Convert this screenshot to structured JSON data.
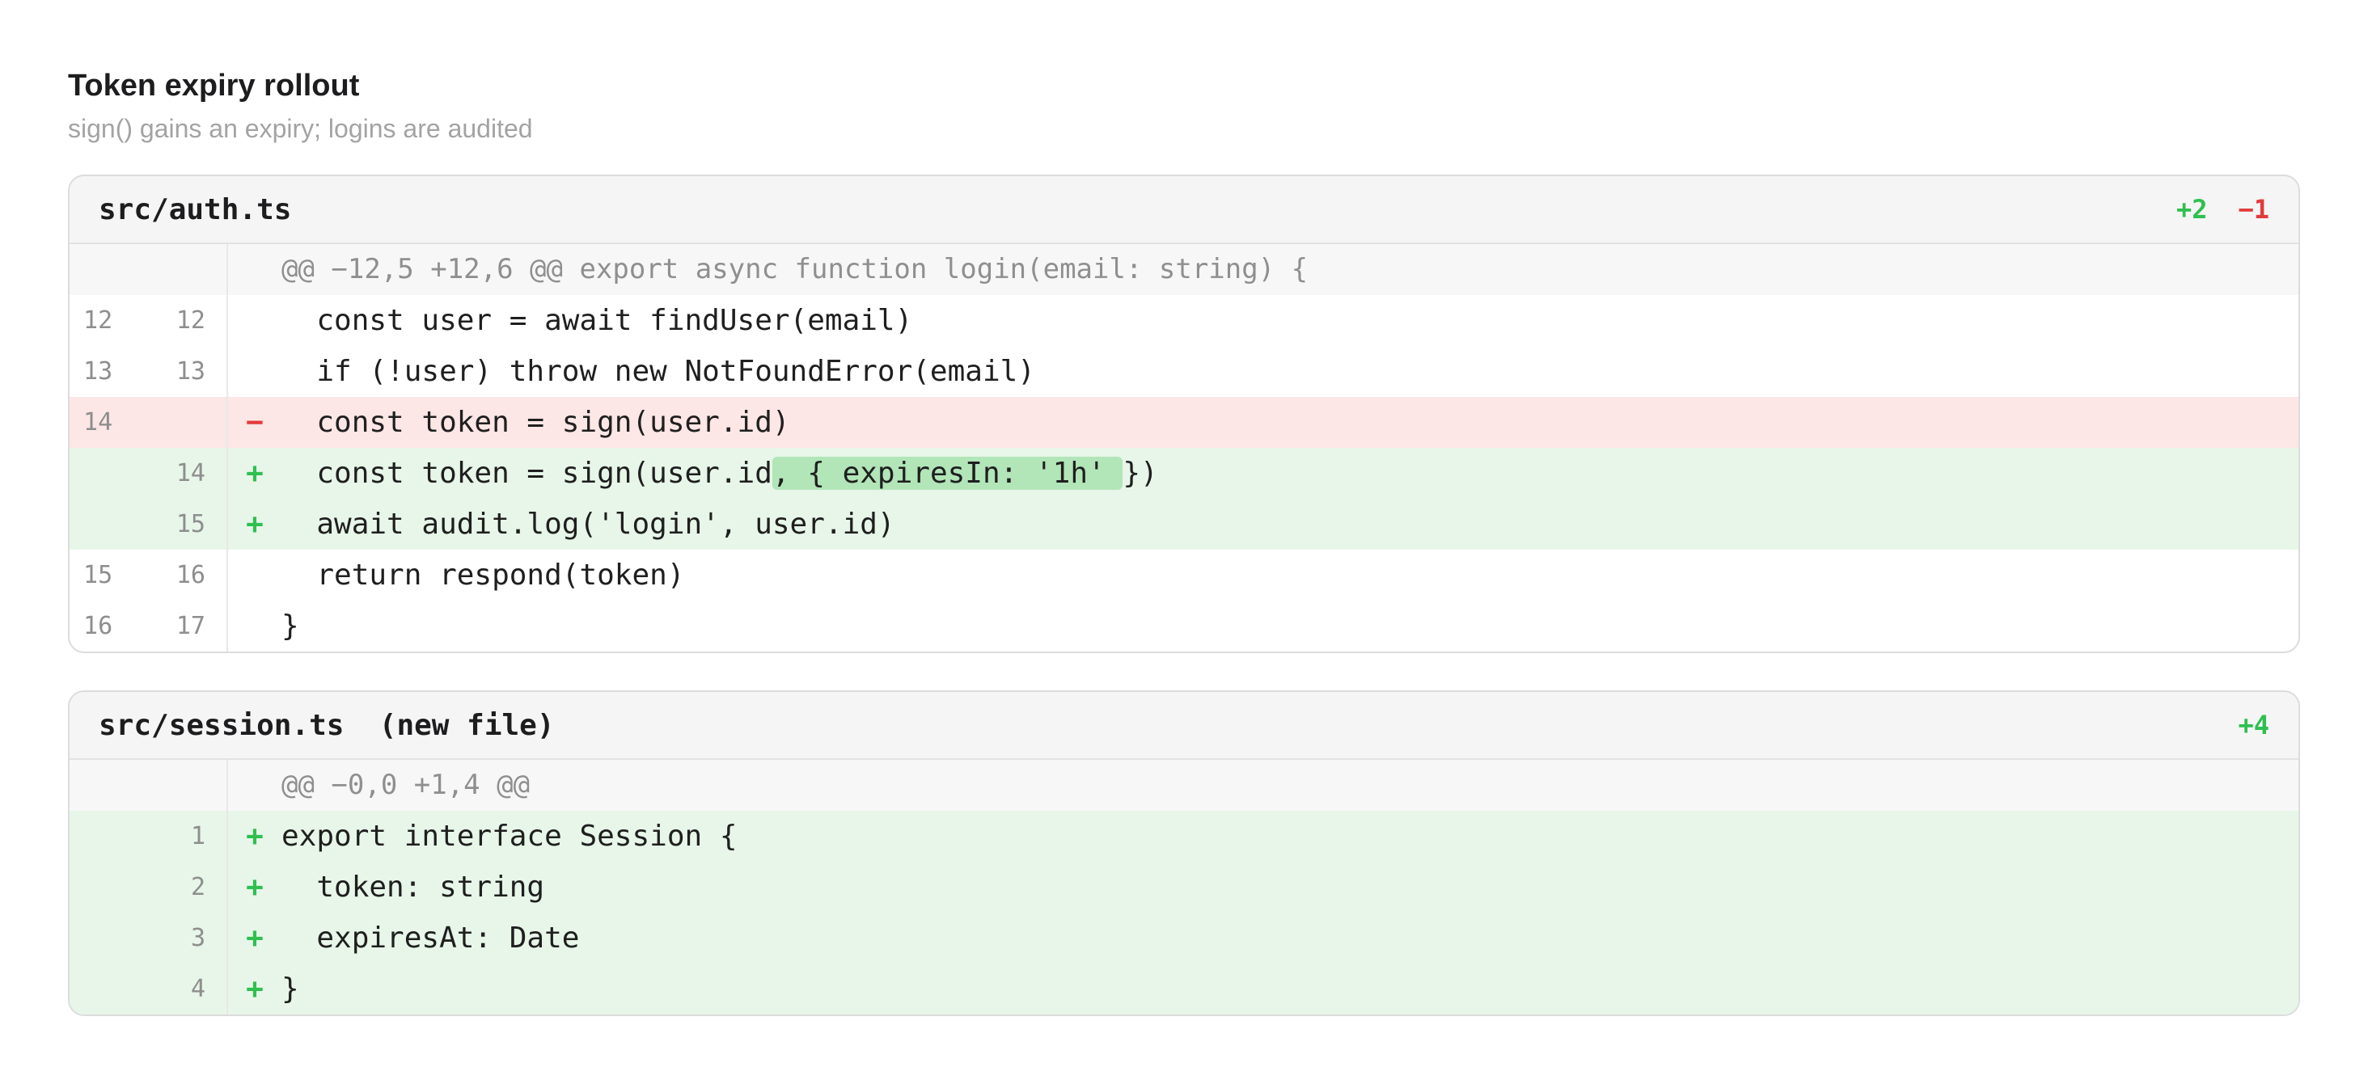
{
  "header": {
    "title": "Token expiry rollout",
    "subtitle": "sign() gains an expiry; logins are audited"
  },
  "files": [
    {
      "name": "src/auth.ts",
      "stats": {
        "added": "+2",
        "removed": "−1"
      },
      "hunk": "@@ −12,5 +12,6 @@ export async function login(email: string) {",
      "lines": [
        {
          "old": "12",
          "new": "12",
          "mark": "",
          "code": "  const user = await findUser(email)"
        },
        {
          "old": "13",
          "new": "13",
          "mark": "",
          "code": "  if (!user) throw new NotFoundError(email)"
        },
        {
          "old": "14",
          "new": "",
          "mark": "−",
          "code": "  const token = sign(user.id)"
        },
        {
          "old": "",
          "new": "14",
          "mark": "+",
          "code_pre": "  const token = sign(user.id",
          "code_hl": ", { expiresIn: '1h' ",
          "code_post": "})"
        },
        {
          "old": "",
          "new": "15",
          "mark": "+",
          "code": "  await audit.log('login', user.id)"
        },
        {
          "old": "15",
          "new": "16",
          "mark": "",
          "code": "  return respond(token)"
        },
        {
          "old": "16",
          "new": "17",
          "mark": "",
          "code": "}"
        }
      ]
    },
    {
      "name": "src/session.ts  (new file)",
      "stats": {
        "added": "+4"
      },
      "hunk": "@@ −0,0 +1,4 @@",
      "lines": [
        {
          "old": "",
          "new": "1",
          "mark": "+",
          "code": "export interface Session {"
        },
        {
          "old": "",
          "new": "2",
          "mark": "+",
          "code": "  token: string"
        },
        {
          "old": "",
          "new": "3",
          "mark": "+",
          "code": "  expiresAt: Date"
        },
        {
          "old": "",
          "new": "4",
          "mark": "+",
          "code": "}"
        }
      ]
    }
  ],
  "colors": {
    "added_text": "#2fbf4f",
    "removed_text": "#e33b3b",
    "added_row_bg": "#e7f6e8",
    "removed_row_bg": "#fde6e6",
    "inline_highlight_bg": "#b2e5b8"
  }
}
